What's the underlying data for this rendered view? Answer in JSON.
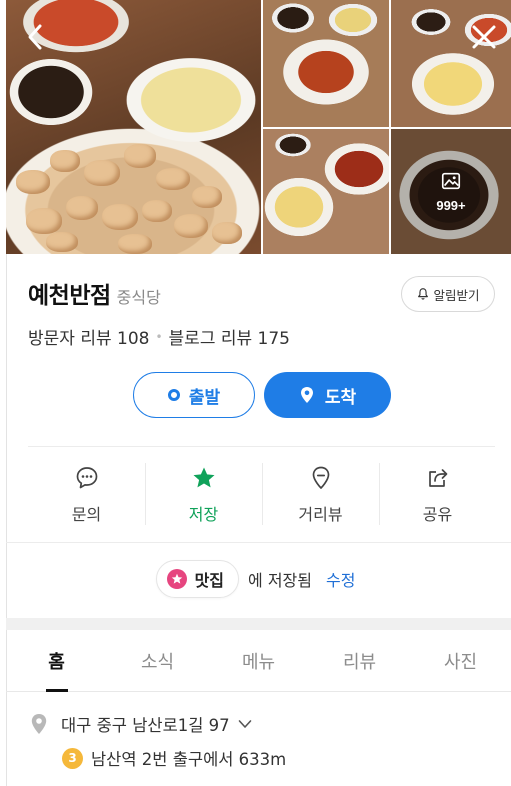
{
  "gallery": {
    "more_count": "999+",
    "icons": {
      "back": "chevron-left-icon",
      "close": "close-icon",
      "more": "image-stack-icon"
    }
  },
  "place": {
    "name": "예천반점",
    "category": "중식당",
    "notify_label": "알림받기",
    "visitor_reviews": "방문자 리뷰 108",
    "blog_reviews": "블로그 리뷰 175"
  },
  "route": {
    "start_label": "출발",
    "end_label": "도착",
    "accent": "#1f7de6"
  },
  "actions": [
    {
      "label": "문의",
      "icon": "chat-bubble-icon"
    },
    {
      "label": "저장",
      "icon": "star-icon",
      "active_color": "#10a25a"
    },
    {
      "label": "거리뷰",
      "icon": "map-pin-outline-icon"
    },
    {
      "label": "공유",
      "icon": "share-icon"
    }
  ],
  "saved": {
    "list_name": "맛집",
    "saved_text": "에 저장됨",
    "edit_label": "수정",
    "chip_color": "#e6457f"
  },
  "tabs": [
    "홈",
    "소식",
    "메뉴",
    "리뷰",
    "사진"
  ],
  "active_tab": "홈",
  "info": {
    "address": "대구 중구 남산로1길 97",
    "subway_line": "3",
    "subway_line_color": "#f5b83a",
    "directions": "남산역 2번 출구에서 633m"
  }
}
